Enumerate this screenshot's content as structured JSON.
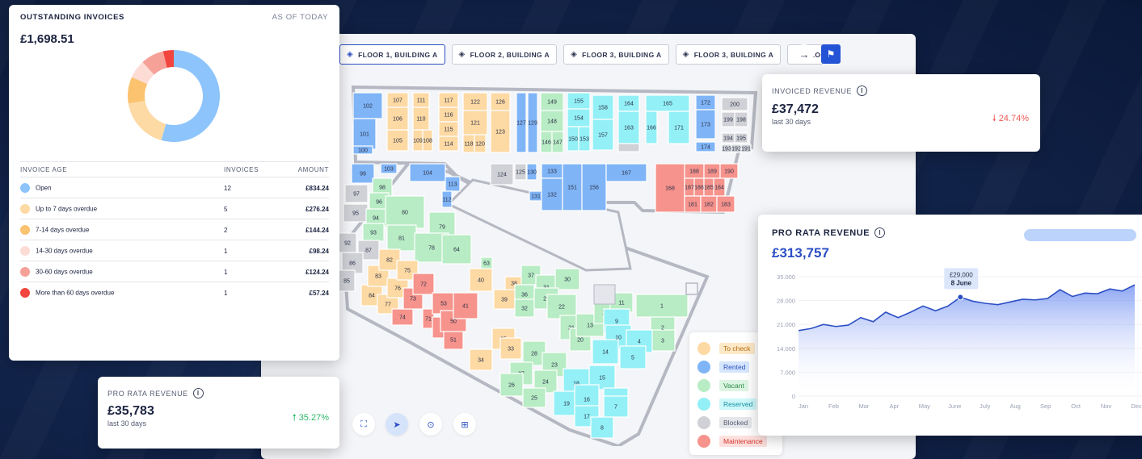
{
  "invoices": {
    "title": "OUTSTANDING INVOICES",
    "as_of": "AS OF TODAY",
    "total": "£1,698.51",
    "columns": [
      "INVOICE AGE",
      "INVOICES",
      "AMOUNT"
    ],
    "rows": [
      {
        "label": "Open",
        "count": "12",
        "amount": "£834.24",
        "color": "#8cc4fb"
      },
      {
        "label": "Up to 7 days overdue",
        "count": "5",
        "amount": "£276.24",
        "color": "#fdd9a3"
      },
      {
        "label": "7-14 days overdue",
        "count": "2",
        "amount": "£144.24",
        "color": "#fbc270"
      },
      {
        "label": "14-30 days overdue",
        "count": "1",
        "amount": "£98.24",
        "color": "#fddcd6"
      },
      {
        "label": "30-60 days overdue",
        "count": "1",
        "amount": "£124.24",
        "color": "#f6a198"
      },
      {
        "label": "More than 60 days overdue",
        "count": "1",
        "amount": "£57.24",
        "color": "#f2453d"
      }
    ],
    "donut_values": [
      834.24,
      276.24,
      144.24,
      98.24,
      124.24,
      57.24
    ]
  },
  "pro_rata_small": {
    "title": "PRO RATA REVENUE",
    "value": "£35,783",
    "sub": "last 30 days",
    "delta": "35.27%",
    "delta_dir": "up"
  },
  "invoiced_revenue": {
    "title": "INVOICED REVENUE",
    "value": "£37,472",
    "sub": "last 30 days",
    "delta": "24.74%",
    "delta_dir": "down"
  },
  "floor_tabs": [
    "FLOOR 1, BUILDING A",
    "FLOOR 2, BUILDING A",
    "FLOOR 3, BUILDING A",
    "FLOOR 3, BUILDING A",
    "FLOO"
  ],
  "legend": [
    {
      "label": "To check",
      "color": "#fdd9a3",
      "bg": "#fde9c8",
      "fg": "#b86e12"
    },
    {
      "label": "Rented",
      "color": "#7fb4f6",
      "bg": "#d5e6fd",
      "fg": "#2c4fc4"
    },
    {
      "label": "Vacant",
      "color": "#b8ecc4",
      "bg": "#dcf5e2",
      "fg": "#2b8a48"
    },
    {
      "label": "Reserved",
      "color": "#93f0f6",
      "bg": "#cdf8fb",
      "fg": "#1492a4"
    },
    {
      "label": "Blocked",
      "color": "#cfd1d6",
      "bg": "#e5e6ea",
      "fg": "#555c72"
    },
    {
      "label": "Maintenance",
      "color": "#f6938c",
      "bg": "#fde0dd",
      "fg": "#d6342c"
    }
  ],
  "floor_rooms": {
    "to_check": [
      "107",
      "106",
      "105",
      "111",
      "110",
      "109",
      "108",
      "117",
      "116",
      "115",
      "114",
      "118",
      "122",
      "121",
      "120",
      "119",
      "126",
      "123",
      "84",
      "83",
      "82",
      "77",
      "76",
      "75",
      "40",
      "39",
      "38",
      "35",
      "34",
      "33",
      "63"
    ],
    "rented": [
      "102",
      "101",
      "100",
      "99",
      "103",
      "104",
      "113",
      "112",
      "128",
      "127",
      "129",
      "130",
      "131",
      "132",
      "133",
      "151",
      "156",
      "167",
      "172",
      "173",
      "174"
    ],
    "vacant": [
      "149",
      "148",
      "146",
      "147",
      "98",
      "96",
      "94",
      "93",
      "92",
      "80",
      "81",
      "79",
      "78",
      "64",
      "37",
      "36",
      "32",
      "31",
      "30",
      "29",
      "28",
      "27",
      "26",
      "25",
      "24",
      "23",
      "22",
      "21",
      "20",
      "13",
      "12",
      "11",
      "1",
      "2",
      "3"
    ],
    "reserved": [
      "155",
      "154",
      "153",
      "150",
      "158",
      "157",
      "164",
      "163",
      "165",
      "171",
      "166",
      "169",
      "168r",
      "19",
      "18",
      "17",
      "16",
      "15",
      "14",
      "10",
      "9",
      "8",
      "7",
      "6",
      "5",
      "4"
    ],
    "blocked": [
      "200",
      "199",
      "198",
      "197",
      "196",
      "195",
      "194",
      "193",
      "192",
      "191",
      "124",
      "125",
      "97",
      "95",
      "87",
      "86",
      "85",
      "90"
    ],
    "maintenance": [
      "168",
      "188",
      "189",
      "190",
      "187",
      "186",
      "185",
      "184",
      "181",
      "182",
      "183",
      "74",
      "73",
      "72",
      "71",
      "70",
      "53",
      "52",
      "51",
      "50",
      "41",
      "44",
      "45",
      "46",
      "47",
      "48",
      "49",
      "43",
      "42"
    ]
  },
  "pro_rata_big": {
    "title": "PRO RATA REVENUE",
    "value": "£313,757"
  },
  "chart_data": {
    "type": "area",
    "x": [
      "Jan",
      "Jan",
      "Feb",
      "Feb",
      "Mar",
      "Mar",
      "Apr",
      "Apr",
      "May",
      "May",
      "June",
      "June",
      "July",
      "July",
      "Aug",
      "Aug",
      "Sep",
      "Sep",
      "Oct",
      "Oct",
      "Nov",
      "Nov",
      "Dec",
      "Dec"
    ],
    "x_ticks": [
      "Jan",
      "Feb",
      "Mar",
      "Apr",
      "May",
      "June",
      "July",
      "Aug",
      "Sep",
      "Oct",
      "Nov",
      "Dec"
    ],
    "values": [
      19200,
      19800,
      21000,
      20400,
      20800,
      23000,
      21800,
      24600,
      23000,
      24600,
      26400,
      25000,
      26400,
      29000,
      27800,
      27200,
      26800,
      27600,
      28400,
      28200,
      28600,
      31200,
      29200,
      30200,
      30000,
      31400,
      30800,
      32600
    ],
    "yticks": [
      0,
      7000,
      14000,
      21000,
      28000,
      35000
    ],
    "ylim": [
      0,
      35000
    ],
    "tooltip": {
      "value": "£29,000",
      "date": "8 June",
      "index": 13
    },
    "series_color": "#2c4fc4"
  }
}
